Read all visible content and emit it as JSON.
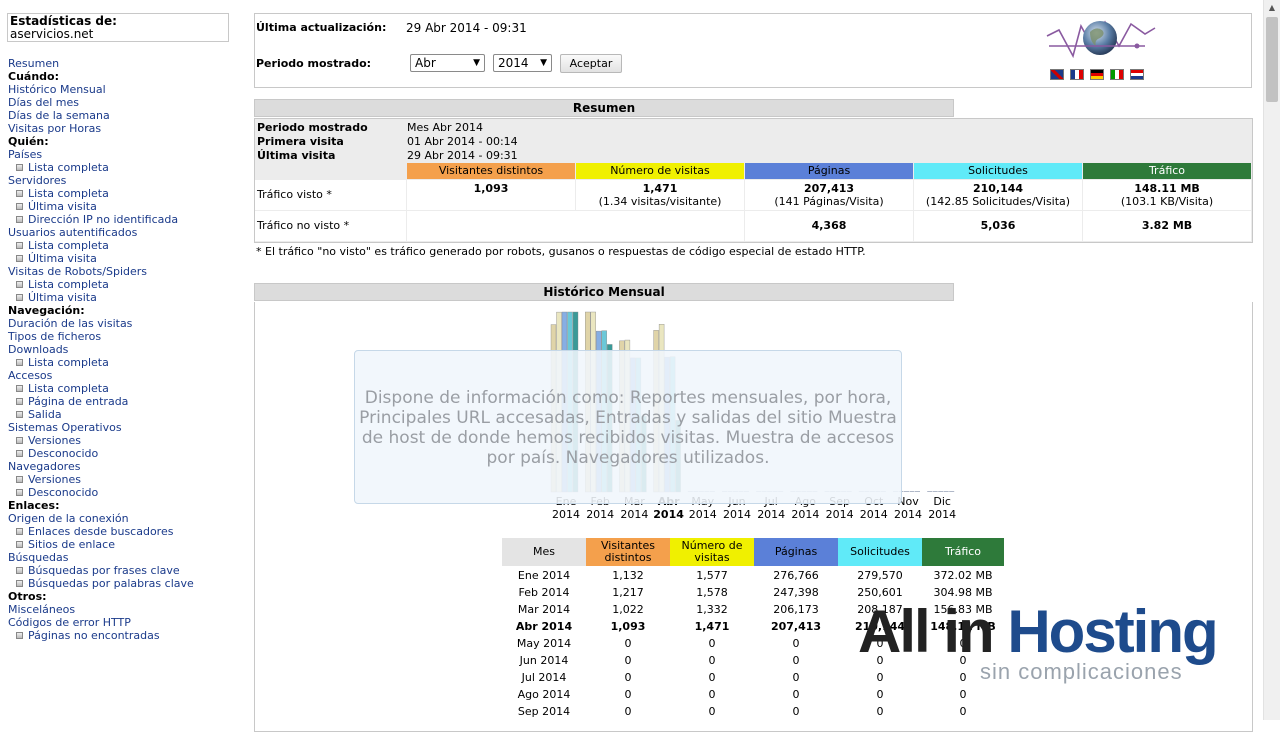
{
  "site": {
    "label": "Estadísticas de:",
    "domain": "aservicios.net"
  },
  "sidebar": [
    {
      "text": "Resumen",
      "kind": "link"
    },
    {
      "text": "Cuándo:",
      "kind": "head"
    },
    {
      "text": "Histórico Mensual",
      "kind": "link"
    },
    {
      "text": "Días del mes",
      "kind": "link"
    },
    {
      "text": "Días de la semana",
      "kind": "link"
    },
    {
      "text": "Visitas por Horas",
      "kind": "link"
    },
    {
      "text": "Quién:",
      "kind": "head"
    },
    {
      "text": "Países",
      "kind": "link"
    },
    {
      "text": "Lista completa",
      "kind": "sub"
    },
    {
      "text": "Servidores",
      "kind": "link"
    },
    {
      "text": "Lista completa",
      "kind": "sub"
    },
    {
      "text": "Última visita",
      "kind": "sub"
    },
    {
      "text": "Dirección IP no identificada",
      "kind": "sub"
    },
    {
      "text": "Usuarios autentificados",
      "kind": "link"
    },
    {
      "text": "Lista completa",
      "kind": "sub"
    },
    {
      "text": "Última visita",
      "kind": "sub"
    },
    {
      "text": "Visitas de Robots/Spiders",
      "kind": "link"
    },
    {
      "text": "Lista completa",
      "kind": "sub"
    },
    {
      "text": "Última visita",
      "kind": "sub"
    },
    {
      "text": "Navegación:",
      "kind": "head"
    },
    {
      "text": "Duración de las visitas",
      "kind": "link"
    },
    {
      "text": "Tipos de ficheros",
      "kind": "link"
    },
    {
      "text": "Downloads",
      "kind": "link"
    },
    {
      "text": "Lista completa",
      "kind": "sub"
    },
    {
      "text": "Accesos",
      "kind": "link"
    },
    {
      "text": "Lista completa",
      "kind": "sub"
    },
    {
      "text": "Página de entrada",
      "kind": "sub"
    },
    {
      "text": "Salida",
      "kind": "sub"
    },
    {
      "text": "Sistemas Operativos",
      "kind": "link"
    },
    {
      "text": "Versiones",
      "kind": "sub"
    },
    {
      "text": "Desconocido",
      "kind": "sub"
    },
    {
      "text": "Navegadores",
      "kind": "link"
    },
    {
      "text": "Versiones",
      "kind": "sub"
    },
    {
      "text": "Desconocido",
      "kind": "sub"
    },
    {
      "text": "Enlaces:",
      "kind": "head"
    },
    {
      "text": "Origen de la conexión",
      "kind": "link"
    },
    {
      "text": "Enlaces desde buscadores",
      "kind": "sub"
    },
    {
      "text": "Sitios de enlace",
      "kind": "sub"
    },
    {
      "text": "Búsquedas",
      "kind": "link"
    },
    {
      "text": "Búsquedas por frases clave",
      "kind": "sub"
    },
    {
      "text": "Búsquedas por palabras clave",
      "kind": "sub"
    },
    {
      "text": "Otros:",
      "kind": "head"
    },
    {
      "text": "Misceláneos",
      "kind": "link"
    },
    {
      "text": "Códigos de error HTTP",
      "kind": "link"
    },
    {
      "text": "Páginas no encontradas",
      "kind": "sub"
    }
  ],
  "header": {
    "last_update_label": "Última actualización:",
    "last_update_value": "29 Abr 2014 - 09:31",
    "period_label": "Periodo mostrado:",
    "month_selected": "Abr",
    "year_selected": "2014",
    "accept_label": "Aceptar"
  },
  "resumen": {
    "title": "Resumen",
    "period_label": "Periodo mostrado",
    "period_value": "Mes Abr 2014",
    "first_visit_label": "Primera visita",
    "first_visit_value": "01 Abr 2014 - 00:14",
    "last_visit_label": "Última visita",
    "last_visit_value": "29 Abr 2014 - 09:31",
    "columns": [
      "Visitantes distintos",
      "Número de visitas",
      "Páginas",
      "Solicitudes",
      "Tráfico"
    ],
    "column_colors": [
      "#f4a04c",
      "#f0f000",
      "#5b80d8",
      "#60eaf8",
      "#2e7a3a"
    ],
    "seen_label": "Tráfico visto *",
    "seen": [
      {
        "main": "1,093",
        "sub": ""
      },
      {
        "main": "1,471",
        "sub": "(1.34 visitas/visitante)"
      },
      {
        "main": "207,413",
        "sub": "(141 Páginas/Visita)"
      },
      {
        "main": "210,144",
        "sub": "(142.85 Solicitudes/Visita)"
      },
      {
        "main": "148.11 MB",
        "sub": "(103.1 KB/Visita)"
      }
    ],
    "unseen_label": "Tráfico no visto *",
    "unseen": [
      "",
      "",
      "4,368",
      "5,036",
      "3.82 MB"
    ],
    "note": "* El tráfico \"no visto\" es tráfico generado por robots, gusanos o respuestas de código especial de estado HTTP."
  },
  "historico": {
    "title": "Histórico Mensual",
    "overlay_text": "Dispone de información como: Reportes mensuales, por hora, Principales URL accesadas, Entradas y salidas del sitio Muestra de host de donde hemos recibidos visitas. Muestra de accesos por país. Navegadores utilizados.",
    "months": [
      "Ene",
      "Feb",
      "Mar",
      "Abr",
      "May",
      "Jun",
      "Jul",
      "Ago",
      "Sep",
      "Oct",
      "Nov",
      "Dic"
    ],
    "year": "2014",
    "current_month_index": 3,
    "table_headers": [
      "Mes",
      "Visitantes distintos",
      "Número de visitas",
      "Páginas",
      "Solicitudes",
      "Tráfico"
    ],
    "header_colors": [
      "#e4e4e4",
      "#f4a04c",
      "#f0f000",
      "#5b80d8",
      "#60eaf8",
      "#2e7a3a"
    ],
    "rows": [
      {
        "mes": "Ene 2014",
        "vis": "1,132",
        "num": "1,577",
        "pag": "276,766",
        "sol": "279,570",
        "tra": "372.02 MB"
      },
      {
        "mes": "Feb 2014",
        "vis": "1,217",
        "num": "1,578",
        "pag": "247,398",
        "sol": "250,601",
        "tra": "304.98 MB"
      },
      {
        "mes": "Mar 2014",
        "vis": "1,022",
        "num": "1,332",
        "pag": "206,173",
        "sol": "208,187",
        "tra": "156.83 MB"
      },
      {
        "mes": "Abr 2014",
        "vis": "1,093",
        "num": "1,471",
        "pag": "207,413",
        "sol": "210,144",
        "tra": "148.11 MB"
      },
      {
        "mes": "May 2014",
        "vis": "0",
        "num": "0",
        "pag": "0",
        "sol": "0",
        "tra": "0"
      },
      {
        "mes": "Jun 2014",
        "vis": "0",
        "num": "0",
        "pag": "0",
        "sol": "0",
        "tra": "0"
      },
      {
        "mes": "Jul 2014",
        "vis": "0",
        "num": "0",
        "pag": "0",
        "sol": "0",
        "tra": "0"
      },
      {
        "mes": "Ago 2014",
        "vis": "0",
        "num": "0",
        "pag": "0",
        "sol": "0",
        "tra": "0"
      },
      {
        "mes": "Sep 2014",
        "vis": "0",
        "num": "0",
        "pag": "0",
        "sol": "0",
        "tra": "0"
      }
    ]
  },
  "chart_data": {
    "type": "bar",
    "categories": [
      "Ene 2014",
      "Feb 2014",
      "Mar 2014",
      "Abr 2014",
      "May 2014",
      "Jun 2014",
      "Jul 2014",
      "Ago 2014",
      "Sep 2014",
      "Oct 2014",
      "Nov 2014",
      "Dic 2014"
    ],
    "series": [
      {
        "name": "Visitantes distintos",
        "color": "#f4a04c",
        "values": [
          1132,
          1217,
          1022,
          1093,
          0,
          0,
          0,
          0,
          0,
          0,
          0,
          0
        ]
      },
      {
        "name": "Número de visitas",
        "color": "#f0f000",
        "values": [
          1577,
          1578,
          1332,
          1471,
          0,
          0,
          0,
          0,
          0,
          0,
          0,
          0
        ]
      },
      {
        "name": "Páginas",
        "color": "#5b80d8",
        "values": [
          276766,
          247398,
          206173,
          207413,
          0,
          0,
          0,
          0,
          0,
          0,
          0,
          0
        ]
      },
      {
        "name": "Solicitudes",
        "color": "#60eaf8",
        "values": [
          279570,
          250601,
          208187,
          210144,
          0,
          0,
          0,
          0,
          0,
          0,
          0,
          0
        ]
      },
      {
        "name": "Tráfico",
        "color": "#2e7a3a",
        "values": [
          372.02,
          304.98,
          156.83,
          148.11,
          0,
          0,
          0,
          0,
          0,
          0,
          0,
          0
        ]
      }
    ]
  },
  "watermark": {
    "brand_a": "All in ",
    "brand_b": "Hosting",
    "tagline": "sin complicaciones"
  }
}
